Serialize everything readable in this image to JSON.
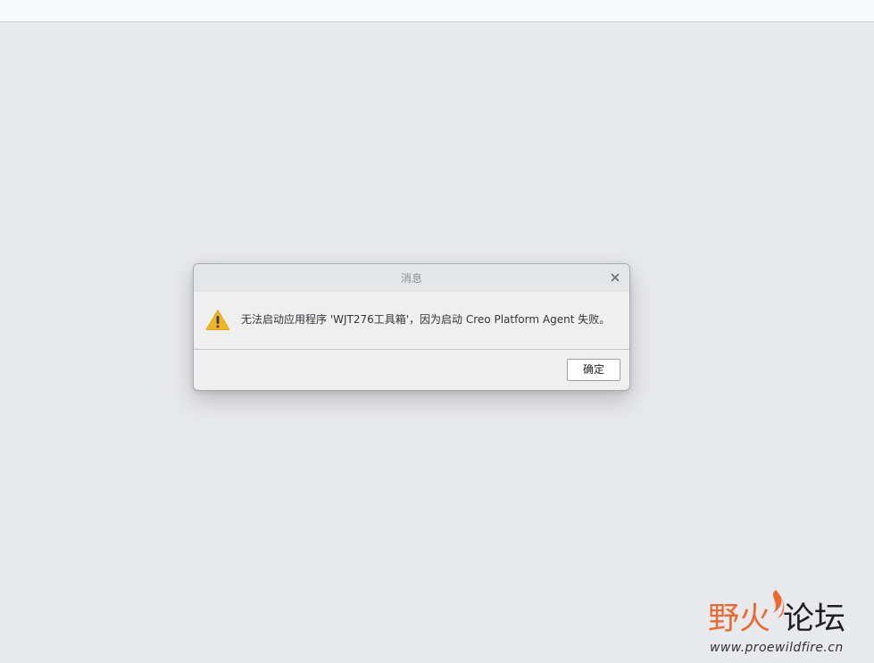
{
  "dialog": {
    "title": "消息",
    "message": "无法启动应用程序 'WJT276工具箱'，因为启动 Creo Platform Agent 失败。",
    "ok_label": "确定",
    "icons": {
      "close": "close-icon",
      "warning": "warning-icon"
    },
    "colors": {
      "warning": "#f0b427",
      "background": "#efeff0"
    }
  },
  "watermark": {
    "brand_orange": "野火",
    "brand_dark": "论坛",
    "url": "www.proewildfire.cn",
    "colors": {
      "accent": "#e86a32"
    }
  }
}
